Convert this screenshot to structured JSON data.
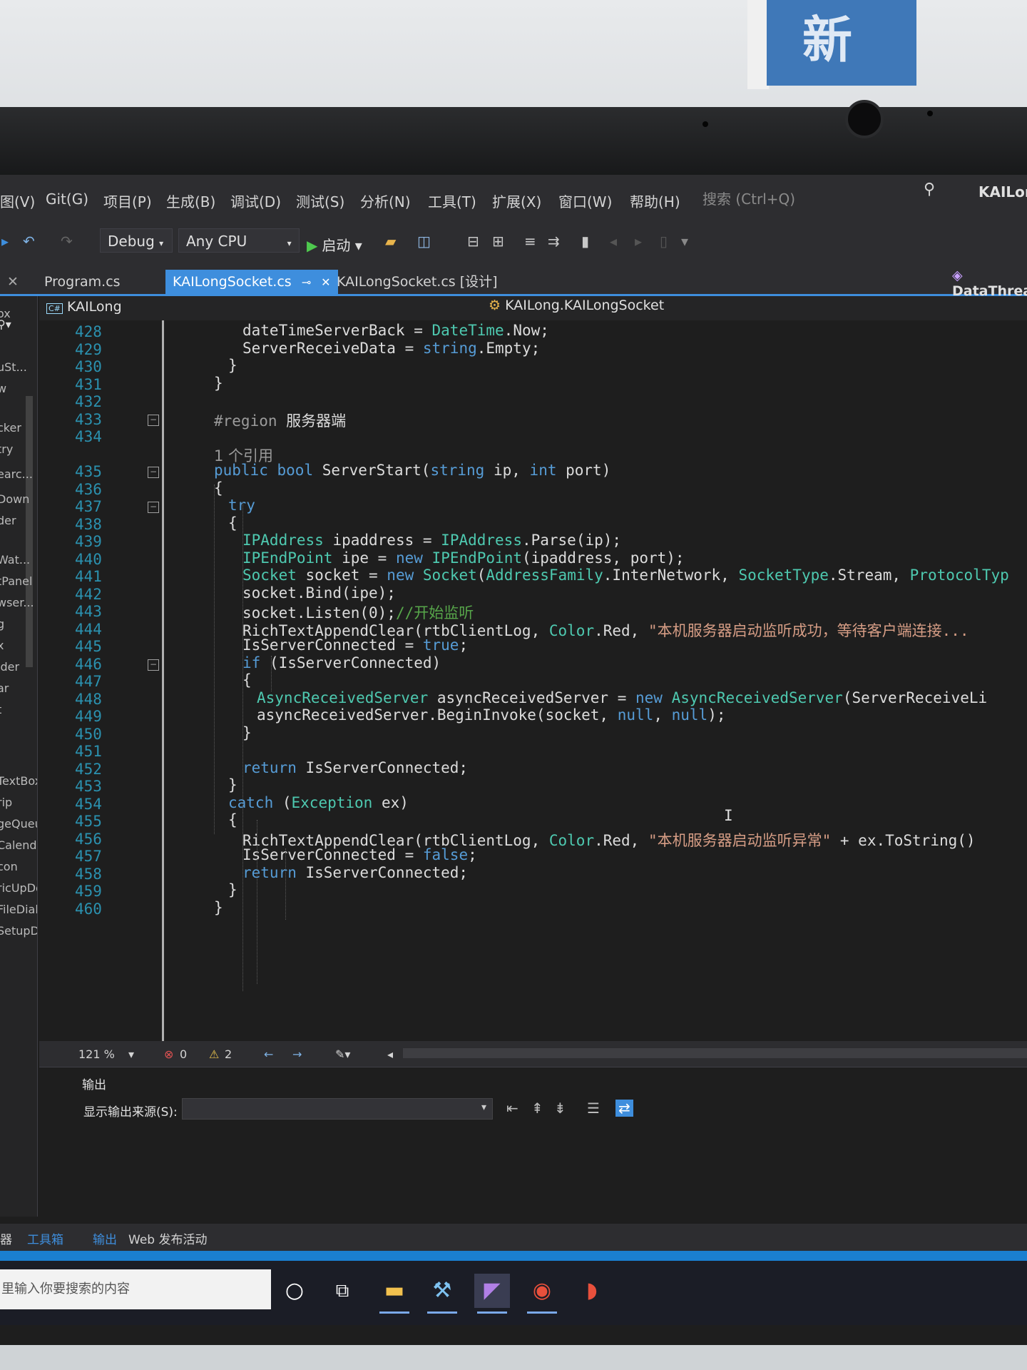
{
  "poster": {
    "glyph": "新"
  },
  "menu": {
    "items": [
      "图(V)",
      "Git(G)",
      "项目(P)",
      "生成(B)",
      "调试(D)",
      "测试(S)",
      "分析(N)",
      "工具(T)",
      "扩展(X)",
      "窗口(W)",
      "帮助(H)"
    ],
    "search_placeholder": "搜索 (Ctrl+Q)",
    "window_title": "KAILon"
  },
  "toolbar": {
    "configuration": "Debug",
    "platform": "Any CPU",
    "start_label": "启动"
  },
  "tabs": [
    {
      "label": "Program.cs",
      "active": false
    },
    {
      "label": "KAILongSocket.cs",
      "active": true
    },
    {
      "label": "KAILongSocket.cs [设计]",
      "active": false
    }
  ],
  "nav": {
    "project": "KAILong",
    "class": "KAILong.KAILongSocket",
    "member": "DataThrea"
  },
  "left_toolbox": [
    "ox",
    "uSt...",
    "w",
    "cker",
    "try",
    "earc...",
    "Down",
    "der",
    "Wat...",
    "tPanel",
    "wser...",
    "g",
    "x",
    "ider",
    "ar",
    "t",
    "l",
    "TextBox",
    "rip",
    "geQueue",
    "Calendar",
    "con",
    "ricUpDo...",
    "FileDialog",
    "SetupDial..."
  ],
  "editor": {
    "line_numbers": [
      "428",
      "429",
      "430",
      "431",
      "432",
      "433",
      "434",
      "435",
      "436",
      "437",
      "438",
      "439",
      "440",
      "441",
      "442",
      "443",
      "444",
      "445",
      "446",
      "447",
      "448",
      "449",
      "450",
      "451",
      "452",
      "453",
      "454",
      "455",
      "456",
      "457",
      "458",
      "459",
      "460"
    ],
    "lines": [
      "dateTimeServerBack = DateTime.Now;",
      "ServerReceiveData = string.Empty;",
      "}",
      "}",
      "",
      "#region 服务器端",
      "",
      "1 个引用",
      "public bool ServerStart(string ip, int port)",
      "{",
      "try",
      "{",
      "IPAddress ipaddress = IPAddress.Parse(ip);",
      "IPEndPoint ipe = new IPEndPoint(ipaddress, port);",
      "Socket socket = new Socket(AddressFamily.InterNetwork, SocketType.Stream, ProtocolTyp",
      "socket.Bind(ipe);",
      "socket.Listen(0);//开始监听",
      "RichTextAppendClear(rtbClientLog, Color.Red, \"本机服务器启动监听成功，等待客户端连接...",
      "IsServerConnected = true;",
      "if (IsServerConnected)",
      "{",
      "AsyncReceivedServer asyncReceivedServer = new AsyncReceivedServer(ServerReceiveLi",
      "asyncReceivedServer.BeginInvoke(socket, null, null);",
      "}",
      "",
      "return IsServerConnected;",
      "}",
      "catch (Exception ex)",
      "{",
      "RichTextAppendClear(rtbClientLog, Color.Red, \"本机服务器启动监听异常\" + ex.ToString()",
      "IsServerConnected = false;",
      "return IsServerConnected;",
      "}",
      "}"
    ]
  },
  "status": {
    "zoom": "121 %",
    "errors": "0",
    "warnings": "2"
  },
  "output": {
    "title": "输出",
    "source_label": "显示输出来源(S):"
  },
  "bottom_tabs": {
    "left_a": "器",
    "left_b": "工具箱",
    "output": "输出",
    "web": "Web 发布活动"
  },
  "taskbar": {
    "search_placeholder": "里输入你要搜索的内容"
  },
  "colors": {
    "keyword": "#569cd6",
    "type": "#4ec9b0",
    "string": "#d69d85",
    "comment": "#57a64a",
    "accent": "#3e8edd"
  }
}
